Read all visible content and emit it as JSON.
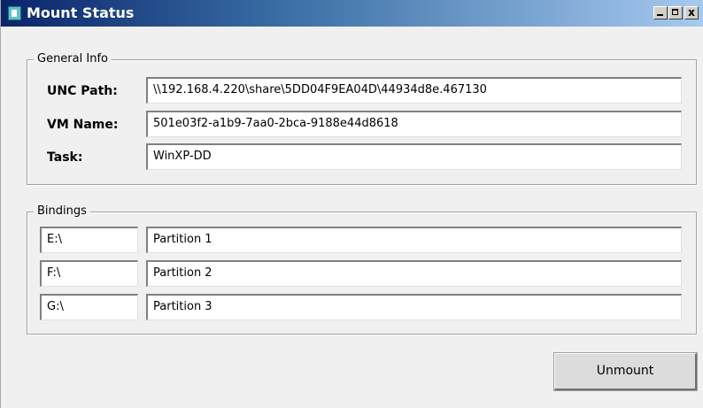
{
  "window": {
    "title": "Mount Status",
    "icon": "app-icon",
    "controls": {
      "minimize_icon": "minimize-icon",
      "maximize_icon": "maximize-icon",
      "close_glyph": "x"
    }
  },
  "general_info": {
    "legend": "General Info",
    "fields": [
      {
        "label": "UNC Path:",
        "value": "\\\\192.168.4.220\\share\\5DD04F9EA04D\\44934d8e.467130"
      },
      {
        "label": "VM Name:",
        "value": "501e03f2-a1b9-7aa0-2bca-9188e44d8618"
      },
      {
        "label": "Task:",
        "value": "WinXP-DD"
      }
    ]
  },
  "bindings": {
    "legend": "Bindings",
    "rows": [
      {
        "drive": "E:\\",
        "partition": "Partition 1"
      },
      {
        "drive": "F:\\",
        "partition": "Partition 2"
      },
      {
        "drive": "G:\\",
        "partition": "Partition 3"
      }
    ]
  },
  "actions": {
    "unmount_label": "Unmount"
  }
}
